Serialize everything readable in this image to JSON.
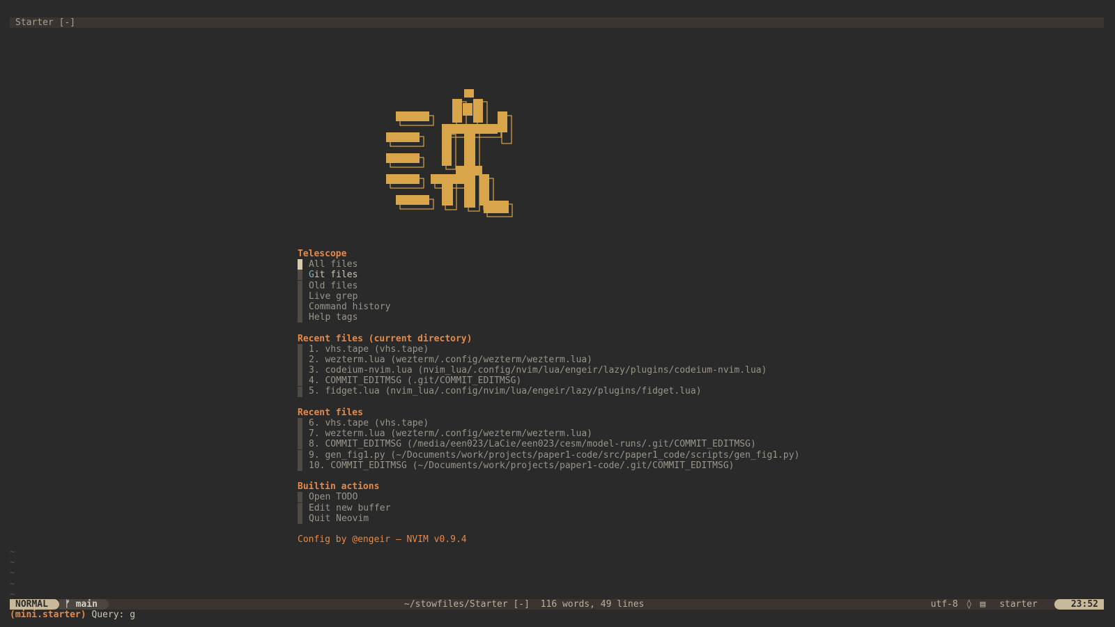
{
  "tabline": {
    "title": "Starter [-]"
  },
  "colors": {
    "accent": "#e58a4b",
    "logo": "#d9a54a",
    "background": "#2a2a2a"
  },
  "sections": [
    {
      "title": "Telescope",
      "items": [
        {
          "label": "All files"
        },
        {
          "label": "Git files",
          "highlight": "G",
          "rest": "it files"
        },
        {
          "label": "Old files"
        },
        {
          "label": "Live grep"
        },
        {
          "label": "Command history"
        },
        {
          "label": "Help tags"
        }
      ]
    },
    {
      "title": "Recent files (current directory)",
      "items": [
        {
          "label": "1. vhs.tape (vhs.tape)"
        },
        {
          "label": "2. wezterm.lua (wezterm/.config/wezterm/wezterm.lua)"
        },
        {
          "label": "3. codeium-nvim.lua (nvim_lua/.config/nvim/lua/engeir/lazy/plugins/codeium-nvim.lua)"
        },
        {
          "label": "4. COMMIT_EDITMSG (.git/COMMIT_EDITMSG)"
        },
        {
          "label": "5. fidget.lua (nvim_lua/.config/nvim/lua/engeir/lazy/plugins/fidget.lua)"
        }
      ]
    },
    {
      "title": "Recent files",
      "items": [
        {
          "label": "6. vhs.tape (vhs.tape)"
        },
        {
          "label": "7. wezterm.lua (wezterm/.config/wezterm/wezterm.lua)"
        },
        {
          "label": "8. COMMIT_EDITMSG (/media/een023/LaCie/een023/cesm/model-runs/.git/COMMIT_EDITMSG)"
        },
        {
          "label": "9. gen_fig1.py (~/Documents/work/projects/paper1-code/src/paper1_code/scripts/gen_fig1.py)"
        },
        {
          "label": "10. COMMIT_EDITMSG (~/Documents/work/projects/paper1-code/.git/COMMIT_EDITMSG)"
        }
      ]
    },
    {
      "title": "Builtin actions",
      "items": [
        {
          "label": "Open TODO"
        },
        {
          "label": "Edit new buffer"
        },
        {
          "label": "Quit Neovim"
        }
      ]
    }
  ],
  "footer": "Config by @engeir — NVIM v0.9.4",
  "tildes": [
    "~",
    "~",
    "~",
    "~",
    "~"
  ],
  "statusline": {
    "mode": "NORMAL",
    "branch_icon": "ᚠ",
    "branch": "main",
    "file": "~/stowfiles/Starter [-]",
    "stats": "116 words, 49 lines",
    "encoding": "utf-8",
    "os_icon": "◊",
    "ft_icon": "▤",
    "filetype": "starter",
    "time": "23:52"
  },
  "cmdline": {
    "plugin": "(mini.starter)",
    "query_label": "Query:",
    "query": "g"
  }
}
